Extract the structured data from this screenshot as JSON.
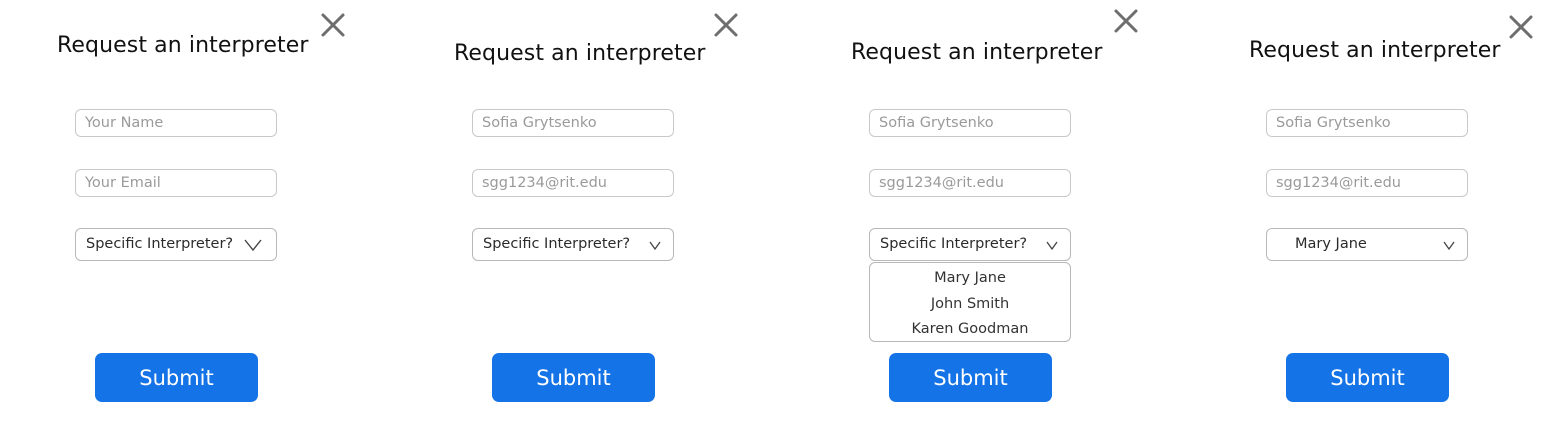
{
  "panels": [
    {
      "title": "Request an interpreter",
      "name_field": {
        "value": "",
        "placeholder": "Your Name"
      },
      "email_field": {
        "value": "",
        "placeholder": "Your Email"
      },
      "interpreter_select": {
        "selected": "Specific Interpreter?"
      },
      "submit_label": "Submit"
    },
    {
      "title": "Request an interpreter",
      "name_field": {
        "value": "Sofia Grytsenko",
        "placeholder": ""
      },
      "email_field": {
        "value": "sgg1234@rit.edu",
        "placeholder": ""
      },
      "interpreter_select": {
        "selected": "Specific Interpreter?"
      },
      "submit_label": "Submit"
    },
    {
      "title": "Request an interpreter",
      "name_field": {
        "value": "Sofia Grytsenko",
        "placeholder": ""
      },
      "email_field": {
        "value": "sgg1234@rit.edu",
        "placeholder": ""
      },
      "interpreter_select": {
        "selected": "Specific Interpreter?",
        "options": [
          "Mary Jane",
          "John Smith",
          "Karen Goodman"
        ]
      },
      "submit_label": "Submit"
    },
    {
      "title": "Request an interpreter",
      "name_field": {
        "value": "Sofia Grytsenko",
        "placeholder": ""
      },
      "email_field": {
        "value": "sgg1234@rit.edu",
        "placeholder": ""
      },
      "interpreter_select": {
        "selected": "Mary Jane"
      },
      "submit_label": "Submit"
    }
  ],
  "icons": {
    "close": "close-icon",
    "chevron": "chevron-down-icon"
  },
  "colors": {
    "submit_button": "#1473e6",
    "submit_text": "#ffffff",
    "close_icon": "#6e6e6e",
    "field_border": "#c9c9c9",
    "placeholder_text": "#9a9a9a"
  }
}
